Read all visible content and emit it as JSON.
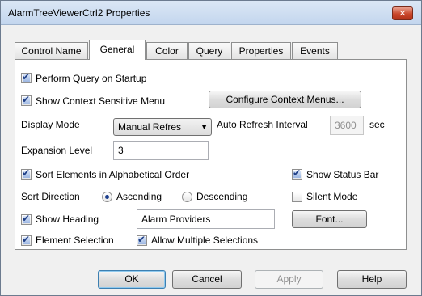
{
  "window": {
    "title": "AlarmTreeViewerCtrl2 Properties",
    "close_glyph": "✕"
  },
  "tabs": [
    {
      "label": "Control Name"
    },
    {
      "label": "General",
      "active": true
    },
    {
      "label": "Color"
    },
    {
      "label": "Query"
    },
    {
      "label": "Properties"
    },
    {
      "label": "Events"
    }
  ],
  "general": {
    "perform_query_label": "Perform Query on Startup",
    "perform_query_checked": true,
    "context_menu_label": "Show Context Sensitive Menu",
    "context_menu_checked": true,
    "configure_context_label": "Configure Context Menus...",
    "display_mode_label": "Display Mode",
    "display_mode_value": "Manual Refres",
    "auto_refresh_label": "Auto Refresh Interval",
    "auto_refresh_value": "3600",
    "auto_refresh_unit": "sec",
    "expansion_level_label": "Expansion Level",
    "expansion_level_value": "3",
    "sort_alpha_label": "Sort Elements in Alphabetical Order",
    "sort_alpha_checked": true,
    "status_bar_label": "Show Status Bar",
    "status_bar_checked": true,
    "sort_direction_label": "Sort Direction",
    "ascending_label": "Ascending",
    "descending_label": "Descending",
    "sort_direction_selected": "Ascending",
    "silent_mode_label": "Silent Mode",
    "silent_mode_checked": false,
    "show_heading_label": "Show Heading",
    "show_heading_checked": true,
    "heading_value": "Alarm Providers",
    "font_label": "Font...",
    "element_selection_label": "Element Selection",
    "element_selection_checked": true,
    "multi_select_label": "Allow Multiple Selections",
    "multi_select_checked": true
  },
  "footer": {
    "ok_label": "OK",
    "cancel_label": "Cancel",
    "apply_label": "Apply",
    "help_label": "Help"
  },
  "icons": {
    "checkmark": "✔",
    "dropdown": "▼"
  },
  "colors": {
    "accent": "#3c7fb1",
    "close": "#c9472b",
    "check": "#1e3e86"
  }
}
